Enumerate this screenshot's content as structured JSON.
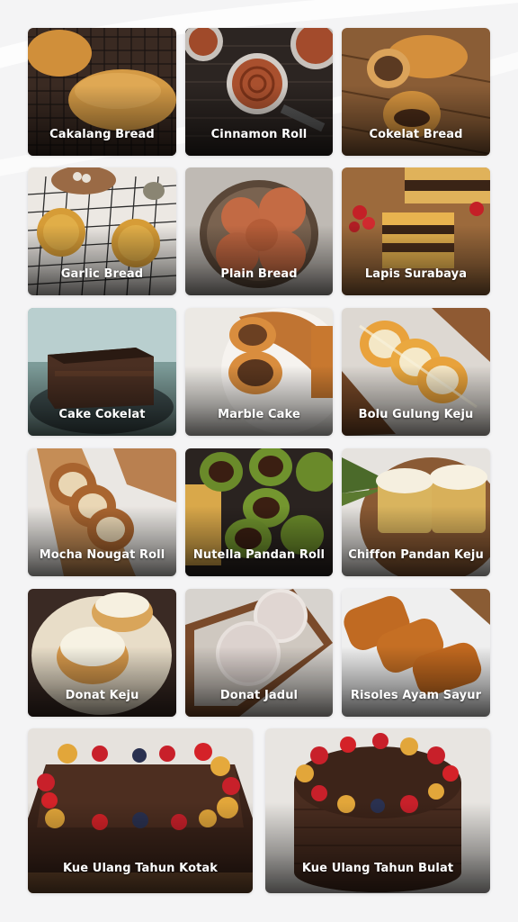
{
  "menu": {
    "items": [
      {
        "name": "Cakalang Bread",
        "image": "cakalang-bread-photo"
      },
      {
        "name": "Cinnamon Roll",
        "image": "cinnamon-roll-photo"
      },
      {
        "name": "Cokelat Bread",
        "image": "cokelat-bread-photo"
      },
      {
        "name": "Garlic Bread",
        "image": "garlic-bread-photo"
      },
      {
        "name": "Plain Bread",
        "image": "plain-bread-photo"
      },
      {
        "name": "Lapis Surabaya",
        "image": "lapis-surabaya-photo"
      },
      {
        "name": "Cake Cokelat",
        "image": "cake-cokelat-photo"
      },
      {
        "name": "Marble Cake",
        "image": "marble-cake-photo"
      },
      {
        "name": "Bolu Gulung Keju",
        "image": "bolu-gulung-keju-photo"
      },
      {
        "name": "Mocha Nougat Roll",
        "image": "mocha-nougat-roll-photo"
      },
      {
        "name": "Nutella Pandan Roll",
        "image": "nutella-pandan-roll-photo"
      },
      {
        "name": "Chiffon Pandan Keju",
        "image": "chiffon-pandan-keju-photo"
      },
      {
        "name": "Donat Keju",
        "image": "donat-keju-photo"
      },
      {
        "name": "Donat Jadul",
        "image": "donat-jadul-photo"
      },
      {
        "name": "Risoles Ayam Sayur",
        "image": "risoles-ayam-sayur-photo"
      },
      {
        "name": "Kue Ulang Tahun Kotak",
        "image": "kue-ulang-tahun-kotak-photo"
      },
      {
        "name": "Kue Ulang Tahun Bulat",
        "image": "kue-ulang-tahun-bulat-photo"
      }
    ]
  }
}
